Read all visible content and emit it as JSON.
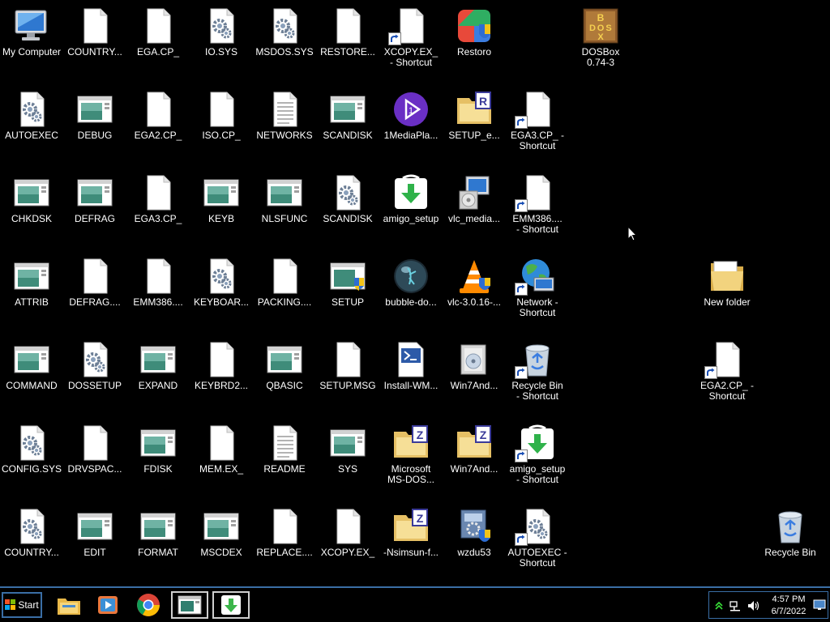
{
  "desktop": {
    "icons": [
      {
        "label": "My Computer",
        "icon": "computer-icon"
      },
      {
        "label": "COUNTRY...",
        "icon": "file-icon"
      },
      {
        "label": "EGA.CP_",
        "icon": "file-icon"
      },
      {
        "label": "IO.SYS",
        "icon": "gear-file-icon"
      },
      {
        "label": "MSDOS.SYS",
        "icon": "gear-file-icon"
      },
      {
        "label": "RESTORE...",
        "icon": "file-icon"
      },
      {
        "label": "XCOPY.EX_\n- Shortcut",
        "icon": "file-icon"
      },
      {
        "label": "Restoro",
        "icon": "restoro-icon"
      },
      {
        "label": "DOSBox\n0.74-3",
        "icon": "dosbox-icon"
      },
      {
        "label": "AUTOEXEC",
        "icon": "gear-file-icon"
      },
      {
        "label": "DEBUG",
        "icon": "app-window-icon"
      },
      {
        "label": "EGA2.CP_",
        "icon": "file-icon"
      },
      {
        "label": "ISO.CP_",
        "icon": "file-icon"
      },
      {
        "label": "NETWORKS",
        "icon": "text-file-icon"
      },
      {
        "label": "SCANDISK",
        "icon": "app-window-icon"
      },
      {
        "label": "1MediaPla...",
        "icon": "media-player-icon"
      },
      {
        "label": "SETUP_e...",
        "icon": "winrar-folder-icon"
      },
      {
        "label": "EGA3.CP_ -\nShortcut",
        "icon": "file-icon"
      },
      {
        "label": "CHKDSK",
        "icon": "app-window-icon"
      },
      {
        "label": "DEFRAG",
        "icon": "app-window-icon"
      },
      {
        "label": "EGA3.CP_",
        "icon": "file-icon"
      },
      {
        "label": "KEYB",
        "icon": "app-window-icon"
      },
      {
        "label": "NLSFUNC",
        "icon": "app-window-icon"
      },
      {
        "label": "SCANDISK",
        "icon": "gear-file-icon"
      },
      {
        "label": "amigo_setup",
        "icon": "download-icon"
      },
      {
        "label": "vlc_media...",
        "icon": "installer-icon"
      },
      {
        "label": "EMM386....\n- Shortcut",
        "icon": "file-icon"
      },
      {
        "label": "ATTRIB",
        "icon": "app-window-icon"
      },
      {
        "label": "DEFRAG....",
        "icon": "file-icon"
      },
      {
        "label": "EMM386....",
        "icon": "file-icon"
      },
      {
        "label": "KEYBOAR...",
        "icon": "gear-file-icon"
      },
      {
        "label": "PACKING....",
        "icon": "file-icon"
      },
      {
        "label": "SETUP",
        "icon": "app-shield-icon"
      },
      {
        "label": "bubble-do...",
        "icon": "bubble-icon"
      },
      {
        "label": "vlc-3.0.16-...",
        "icon": "vlc-cone-icon"
      },
      {
        "label": "Network -\nShortcut",
        "icon": "network-icon"
      },
      {
        "label": "New folder",
        "icon": "folder-icon"
      },
      {
        "label": "COMMAND",
        "icon": "app-window-icon"
      },
      {
        "label": "DOSSETUP",
        "icon": "gear-file-icon"
      },
      {
        "label": "EXPAND",
        "icon": "app-window-icon"
      },
      {
        "label": "KEYBRD2...",
        "icon": "file-icon"
      },
      {
        "label": "QBASIC",
        "icon": "app-window-icon"
      },
      {
        "label": "SETUP.MSG",
        "icon": "file-icon"
      },
      {
        "label": "Install-WM...",
        "icon": "powershell-file-icon"
      },
      {
        "label": "Win7And...",
        "icon": "installer-box-icon"
      },
      {
        "label": "Recycle Bin\n- Shortcut",
        "icon": "recycle-bin-icon"
      },
      {
        "label": "EGA2.CP_ -\nShortcut",
        "icon": "file-icon"
      },
      {
        "label": "CONFIG.SYS",
        "icon": "gear-file-icon"
      },
      {
        "label": "DRVSPAC...",
        "icon": "file-icon"
      },
      {
        "label": "FDISK",
        "icon": "app-window-icon"
      },
      {
        "label": "MEM.EX_",
        "icon": "file-icon"
      },
      {
        "label": "README",
        "icon": "text-file-icon"
      },
      {
        "label": "SYS",
        "icon": "app-window-icon"
      },
      {
        "label": "Microsoft\nMS-DOS...",
        "icon": "zip-folder-icon"
      },
      {
        "label": "Win7And...",
        "icon": "zip-folder-icon"
      },
      {
        "label": "amigo_setup\n- Shortcut",
        "icon": "download-icon"
      },
      {
        "label": "COUNTRY...",
        "icon": "gear-file-icon"
      },
      {
        "label": "EDIT",
        "icon": "app-window-icon"
      },
      {
        "label": "FORMAT",
        "icon": "app-window-icon"
      },
      {
        "label": "MSCDEX",
        "icon": "app-window-icon"
      },
      {
        "label": "REPLACE....",
        "icon": "file-icon"
      },
      {
        "label": "XCOPY.EX_",
        "icon": "file-icon"
      },
      {
        "label": "-Nsimsun-f...",
        "icon": "zip-folder-icon"
      },
      {
        "label": "wzdu53",
        "icon": "winzip-driver-icon"
      },
      {
        "label": "AUTOEXEC -\nShortcut",
        "icon": "gear-file-icon"
      },
      {
        "label": "Recycle Bin",
        "icon": "recycle-bin-icon"
      }
    ]
  },
  "taskbar": {
    "start_label": "Start",
    "apps": [
      {
        "name": "file-explorer-icon"
      },
      {
        "name": "media-player-icon"
      },
      {
        "name": "chrome-icon"
      },
      {
        "name": "app-window-icon"
      },
      {
        "name": "download-icon"
      }
    ],
    "clock_time": "4:57 PM",
    "clock_date": "6/7/2022"
  },
  "colors": {
    "desktop_bg": "#000000",
    "taskbar_border": "#3a6ea5",
    "clock_text": "#ffffff"
  }
}
